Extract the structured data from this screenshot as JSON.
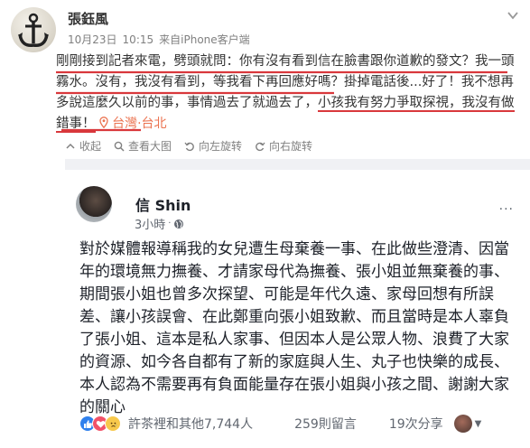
{
  "post": {
    "author": "張鈺風",
    "date": "10月23日",
    "time": "10:15",
    "source_prefix": "来自",
    "source": "iPhone客户端",
    "text_parts": [
      "剛剛接到記者來電，劈頭就問：你有沒有看到信在臉書跟你道歉的發文？我一頭霧水。沒有，我沒有看到，等我看下再回應好嗎？掛掉電話後...好了！我不想再多說這麼久以前的事，事情過去了就過去了，",
      "小孩我有努力爭取探視，我沒有做錯事！"
    ],
    "location": "台灣·台北"
  },
  "toolbar": {
    "collapse": "收起",
    "view_large": "查看大图",
    "rotate_left": "向左旋转",
    "rotate_right": "向右旋转"
  },
  "fb_post": {
    "author": "信 Shin",
    "time": "3小時",
    "dot": "·",
    "more": "···",
    "text": "對於媒體報導稱我的女兒遭生母棄養一事、在此做些澄清、因當年的環境無力撫養、才請家母代為撫養、張小姐並無棄養的事、期間張小姐也曾多次探望、可能是年代久遠、家母回想有所誤差、讓小孩誤會、在此鄭重向張小姐致歉、而且當時是本人辜負了張小姐、這本是私人家事、但因本人是公眾人物、浪費了大家的資源、如今各自都有了新的家庭與人生、丸子也快樂的成長、本人認為不需要再有負面能量存在張小姐與小孩之間、謝謝大家的關心",
    "reactions_text": "許茶裡和其他7,744人",
    "comments": "259則留言",
    "shares": "19次分享"
  },
  "colors": {
    "underline": "#d9383c",
    "location": "#eb7350",
    "like": "#2f80ed",
    "love": "#f25268",
    "sad": "#f7c84b"
  },
  "icons": [
    "anchor-icon",
    "chevron-down-icon",
    "location-pin-icon",
    "collapse-icon",
    "zoom-icon",
    "rotate-left-icon",
    "rotate-right-icon",
    "globe-icon",
    "like-reaction-icon",
    "love-reaction-icon",
    "sad-reaction-icon"
  ]
}
